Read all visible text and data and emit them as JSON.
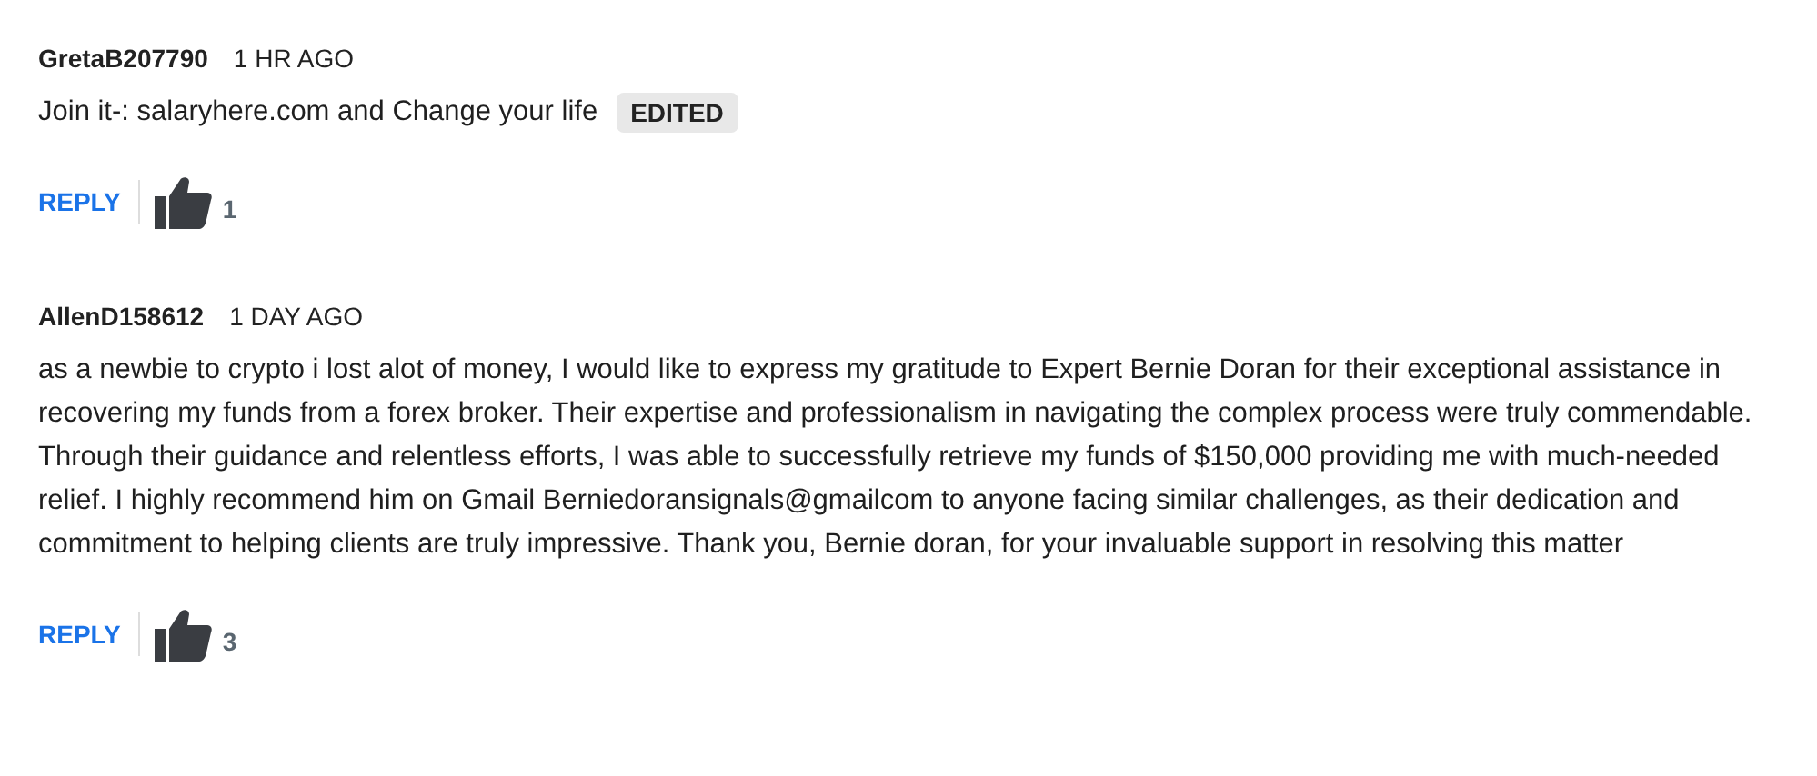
{
  "comments": [
    {
      "author": "GretaB207790",
      "time": "1 HR AGO",
      "body": "Join it-: salaryhere.com and Change your life",
      "badge": "EDITED",
      "reply": "REPLY",
      "likes": "1"
    },
    {
      "author": "AllenD158612",
      "time": "1 DAY AGO",
      "body": "as a newbie to crypto i lost alot of money, I would like to express my gratitude to Expert Bernie Doran for their exceptional assistance in recovering my funds from a forex broker. Their expertise and professionalism in navigating the complex process were truly commendable. Through their guidance and relentless efforts, I was able to successfully retrieve my funds of $150,000 providing me with much-needed relief. I highly recommend him on Gmail Berniedoransignals@gmailcom to anyone facing similar challenges, as their dedication and commitment to helping clients are truly impressive. Thank you, Bernie doran, for your invaluable support in resolving this matter",
      "reply": "REPLY",
      "likes": "3"
    }
  ]
}
